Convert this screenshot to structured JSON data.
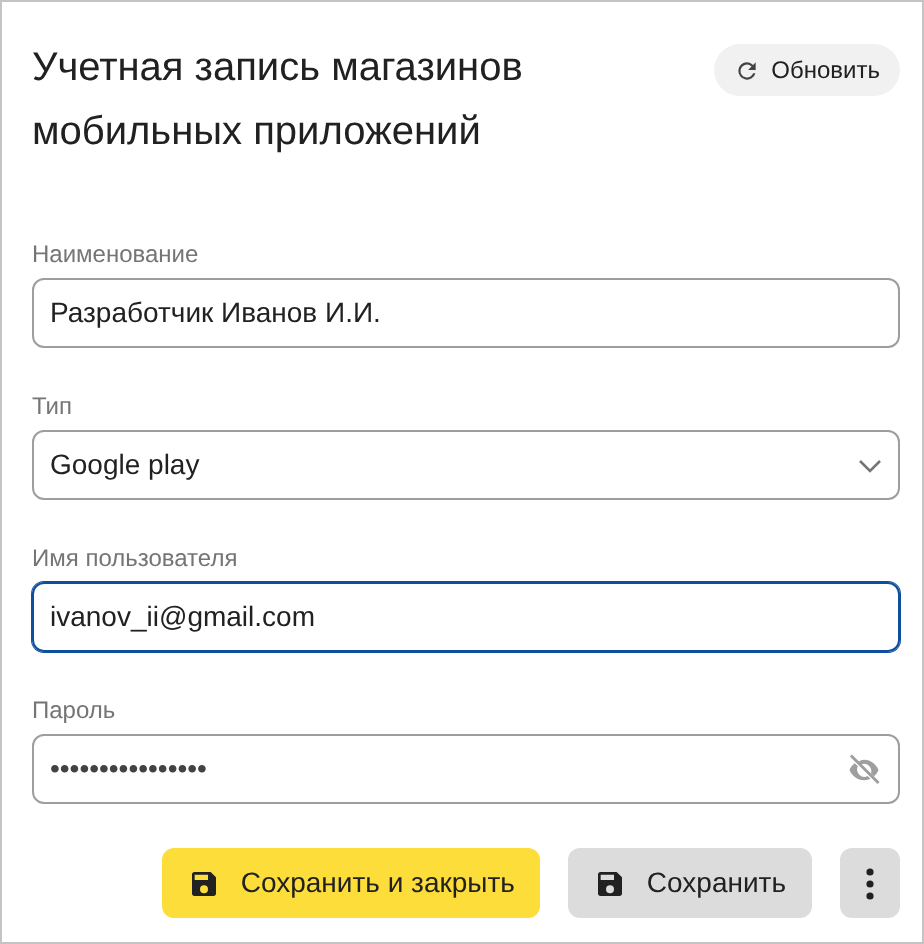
{
  "title": "Учетная запись магазинов мобильных приложений",
  "refresh_button": {
    "label": "Обновить"
  },
  "fields": [
    {
      "kind": "text",
      "label": "Наименование",
      "value": "Разработчик Иванов И.И.",
      "focused": false
    },
    {
      "kind": "select",
      "label": "Тип",
      "value": "Google play",
      "focused": false
    },
    {
      "kind": "text",
      "label": "Имя пользователя",
      "value": "ivanov_ii@gmail.com",
      "focused": true
    },
    {
      "kind": "password",
      "label": "Пароль",
      "value": "••••••••••••••••",
      "focused": false
    }
  ],
  "buttons": [
    {
      "kind": "primary",
      "label": "Сохранить и закрыть"
    },
    {
      "kind": "secondary",
      "label": "Сохранить"
    },
    {
      "kind": "more"
    }
  ]
}
